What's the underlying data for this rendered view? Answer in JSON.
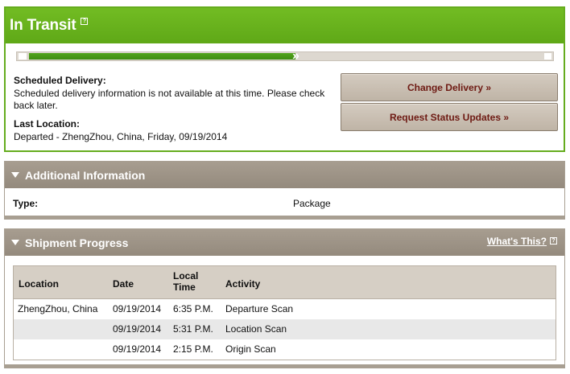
{
  "status": {
    "title": "In Transit",
    "help_icon": "?",
    "progress_fraction": 0.52
  },
  "scheduled": {
    "label": "Scheduled Delivery:",
    "text": "Scheduled delivery information is not available at this time. Please check back later."
  },
  "last_location": {
    "label": "Last Location:",
    "text": "Departed - ZhengZhou, China, Friday, 09/19/2014"
  },
  "buttons": {
    "change_delivery": "Change Delivery »",
    "request_updates": "Request Status Updates »"
  },
  "additional": {
    "title": "Additional Information",
    "type_label": "Type:",
    "type_value": "Package"
  },
  "shipment": {
    "title": "Shipment Progress",
    "whats_this": "What's This?",
    "help_icon": "?",
    "columns": {
      "location": "Location",
      "date": "Date",
      "local_time": "Local Time",
      "activity": "Activity"
    },
    "rows": [
      {
        "location": "ZhengZhou, China",
        "date": "09/19/2014",
        "time": "6:35 P.M.",
        "activity": "Departure Scan"
      },
      {
        "location": "",
        "date": "09/19/2014",
        "time": "5:31 P.M.",
        "activity": "Location Scan"
      },
      {
        "location": "",
        "date": "09/19/2014",
        "time": "2:15 P.M.",
        "activity": "Origin Scan"
      }
    ]
  },
  "colors": {
    "status_green": "#65ac1e",
    "progress_green": "#3f8d12",
    "panel_header": "#a09689",
    "button_text": "#6e1a13"
  }
}
